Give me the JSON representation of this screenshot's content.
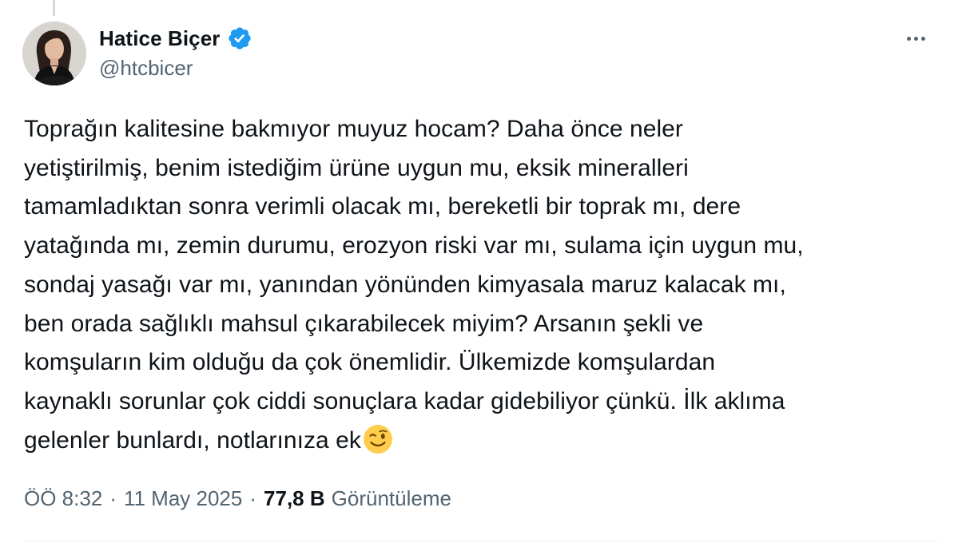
{
  "author": {
    "display_name": "Hatice Biçer",
    "handle": "@htcbicer",
    "verified": true,
    "verified_color": "#1d9bf0"
  },
  "tweet": {
    "text": "Toprağın kalitesine bakmıyor muyuz hocam? Daha önce neler\nyetiştirilmiş, benim istediğim ürüne uygun mu, eksik mineralleri\ntamamladıktan sonra verimli olacak mı, bereketli bir toprak mı, dere\nyatağında mı, zemin durumu, erozyon riski var mı, sulama için uygun mu,\nsondaj yasağı var mı, yanından yönünden kimyasala maruz kalacak mı,\nben orada sağlıklı mahsul çıkarabilecek miyim? Arsanın şekli ve\nkomşuların kim olduğu da çok önemlidir. Ülkemizde komşulardan\nkaynaklı sorunlar çok ciddi sonuçlara kadar gidebiliyor çünkü. İlk aklıma\ngelenler bunlardı, notlarınıza ek",
    "trailing_emoji": "winking-face-emoji"
  },
  "meta": {
    "time": "ÖÖ 8:32",
    "separator": "·",
    "date": "11 May 2025",
    "views_count": "77,8 B",
    "views_label": "Görüntüleme"
  },
  "icons": {
    "more": "more-horizontal-icon",
    "verified": "verified-badge-icon"
  },
  "colors": {
    "text_primary": "#0f1419",
    "text_secondary": "#536471",
    "thread_line": "#cfd9de",
    "divider": "#e6ecf0"
  }
}
